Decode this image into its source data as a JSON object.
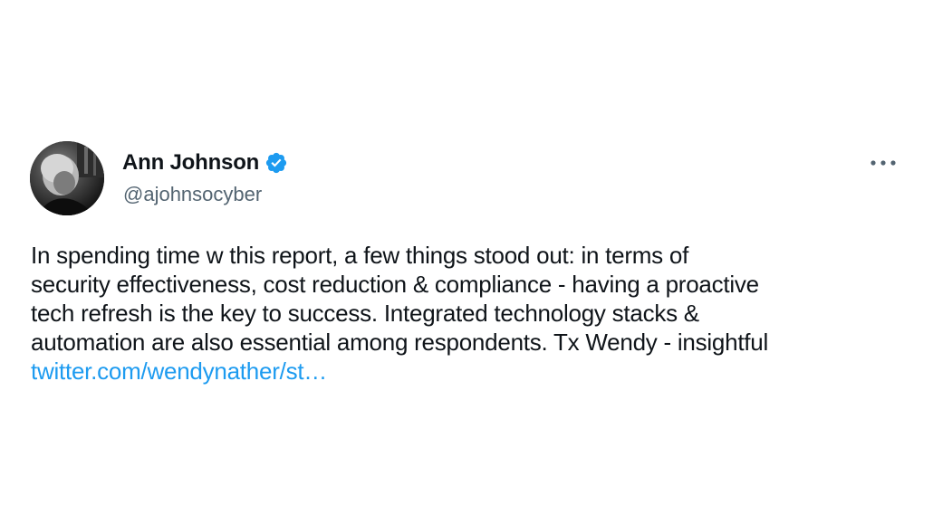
{
  "author": {
    "display_name": "Ann Johnson",
    "handle": "@ajohnsocyber",
    "avatar_icon": "profile-photo",
    "verified_icon": "verified-badge-icon",
    "verified_color": "#1d9bf0"
  },
  "menu": {
    "icon": "more-horizontal-icon"
  },
  "tweet": {
    "lines": [
      "In spending time w this report, a few things stood out: in terms of",
      "security effectiveness, cost reduction & compliance - having a proactive",
      "tech refresh is the key to success. Integrated technology stacks &",
      "automation are also essential among respondents. Tx Wendy - insightful"
    ],
    "link_text": "twitter.com/wendynather/st…",
    "link_color": "#1d9bf0"
  }
}
